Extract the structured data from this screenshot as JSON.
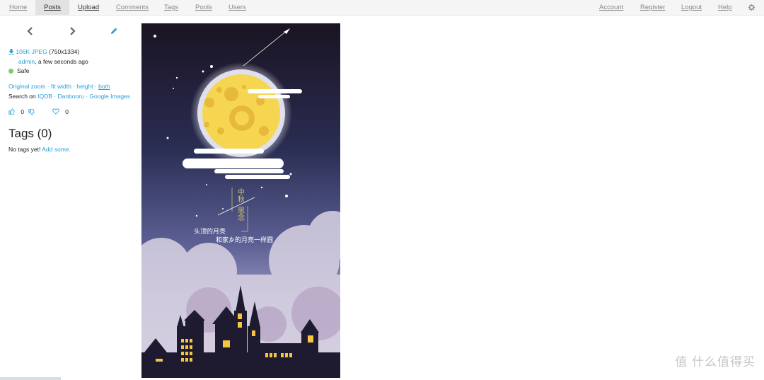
{
  "nav": {
    "home": "Home",
    "posts": "Posts",
    "upload": "Upload",
    "comments": "Comments",
    "tags": "Tags",
    "pools": "Pools",
    "users": "Users",
    "account": "Account",
    "register": "Register",
    "logout": "Logout",
    "help": "Help",
    "settings_icon": "gear-icon"
  },
  "sidebar": {
    "file_link": "106K JPEG",
    "file_dims": "(750x1334)",
    "uploader": "admin",
    "uploaded_time": ", a few seconds ago",
    "safety": "Safe",
    "zoom": {
      "original": "Original zoom",
      "sep1": " · ",
      "fit_width": "fit width",
      "sep2": " · ",
      "height": "height",
      "sep3": " · ",
      "both": "both"
    },
    "search": {
      "prefix": "Search on ",
      "iqdb": "IQDB",
      "sep1": " · ",
      "danbooru": "Danbooru",
      "sep2": " · ",
      "google": "Google Images"
    },
    "score_up": "0",
    "favorites": "0"
  },
  "tags": {
    "heading": "Tags (0)",
    "none_text": "No tags yet! ",
    "add_link": "Add some."
  },
  "image": {
    "vertical_text_1": "中秋",
    "vertical_text_2": "思念",
    "line1": "头顶的月亮",
    "line2": "和家乡的月亮一样圆"
  },
  "watermark": {
    "site_text": "值 什么值得买"
  },
  "colors": {
    "accent": "#2aa0d8",
    "safe": "#7bcc6b"
  }
}
